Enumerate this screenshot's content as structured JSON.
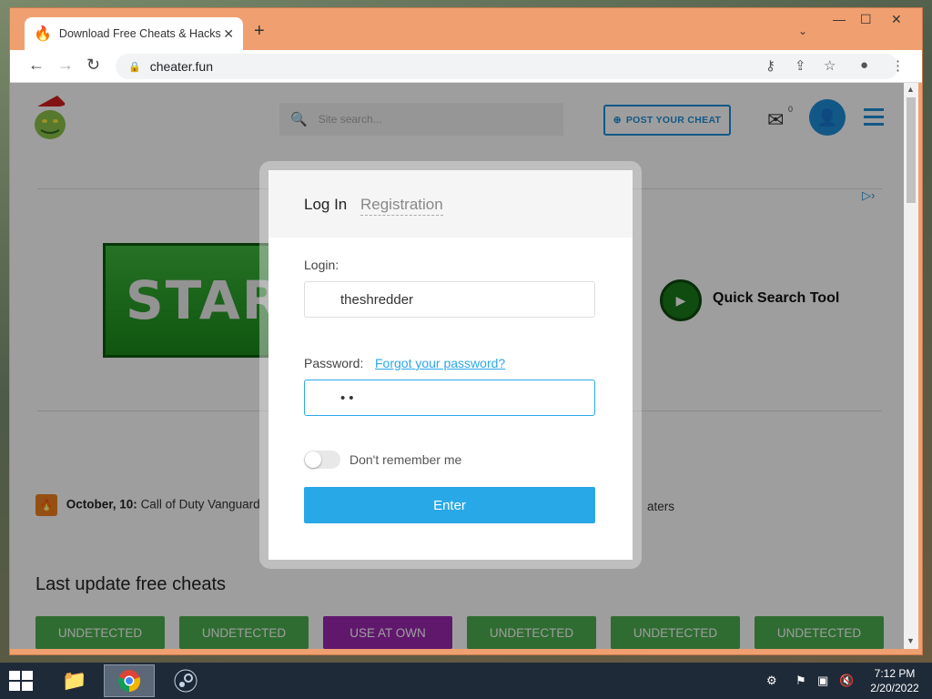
{
  "browser": {
    "tab_title": "Download Free Cheats & Hacks f",
    "url": "cheater.fun"
  },
  "site": {
    "search_placeholder": "Site search...",
    "post_cheat_label": "POST YOUR CHEAT",
    "mail_count": "0",
    "banner_text": "STAR",
    "quick_search_label": "Quick Search Tool",
    "news_date": "October, 10:",
    "news_text": "Call of Duty Vanguard",
    "news_tail": "aters",
    "section_title": "Last update free cheats",
    "cards": [
      "UNDETECTED",
      "UNDETECTED",
      "USE AT OWN",
      "UNDETECTED",
      "UNDETECTED",
      "UNDETECTED"
    ]
  },
  "modal": {
    "tab_login": "Log In",
    "tab_registration": "Registration",
    "login_label": "Login:",
    "login_value": "theshredder",
    "password_label": "Password:",
    "forgot_link": "Forgot your password?",
    "password_value": "••",
    "remember_label": "Don't remember me",
    "remember_on": false,
    "enter_label": "Enter"
  },
  "taskbar": {
    "time": "7:12 PM",
    "date": "2/20/2022"
  },
  "colors": {
    "accent": "#29a8e8",
    "window_frame": "#f0a070",
    "card_green": "#4caf50",
    "card_purple": "#9c27b0"
  }
}
